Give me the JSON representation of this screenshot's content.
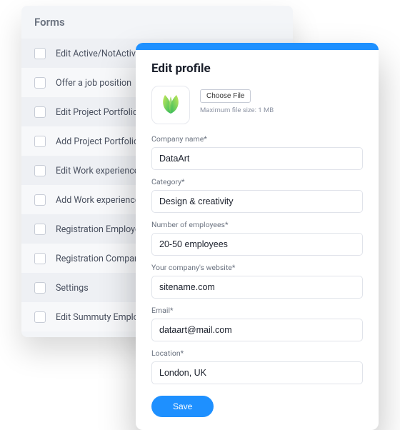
{
  "forms_panel": {
    "title": "Forms",
    "items": [
      "Edit Active/NotActive",
      "Offer a job position",
      "Edit Project Portfolio",
      "Add Project Portfolio",
      "Edit Work experience",
      "Add Work experience",
      "Registration Employee",
      "Registration Company",
      "Settings",
      "Edit Summuty Employee"
    ]
  },
  "modal": {
    "title": "Edit profile",
    "choose_file_label": "Choose File",
    "file_hint": "Maximum file size: 1 MB",
    "fields": {
      "company_name": {
        "label": "Company name*",
        "value": "DataArt"
      },
      "category": {
        "label": "Category*",
        "value": "Design & creativity"
      },
      "employees": {
        "label": "Number of employees*",
        "value": "20-50 employees"
      },
      "website": {
        "label": "Your company's website*",
        "value": "sitename.com"
      },
      "email": {
        "label": "Email*",
        "value": "dataart@mail.com"
      },
      "location": {
        "label": "Location*",
        "value": "London, UK"
      }
    },
    "save_label": "Save"
  },
  "icons": {
    "avatar": "leaf-logo"
  }
}
